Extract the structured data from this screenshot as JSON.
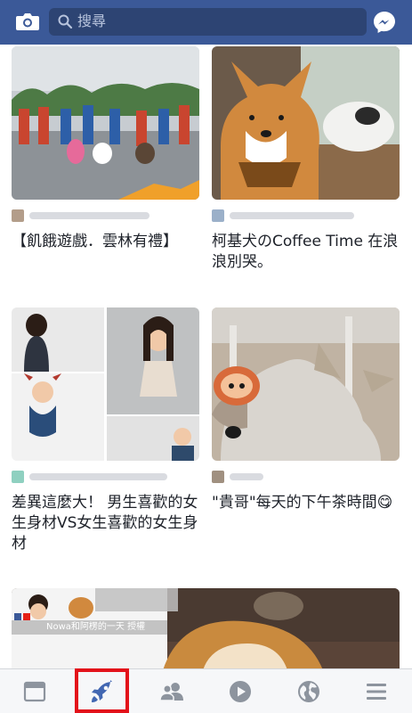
{
  "search": {
    "placeholder": "搜尋"
  },
  "cards": [
    {
      "title": "【飢餓遊戲．雲林有禮】"
    },
    {
      "title": "柯基犬のCoffee Time 在浪浪別哭。"
    },
    {
      "title": "差異這麼大！ 男生喜歡的女生身材VS女生喜歡的女生身材"
    },
    {
      "title": "\"貴哥\"每天的下午茶時間😋"
    }
  ],
  "video_card": {
    "caption": "Nowa和阿楞的一天 授權"
  },
  "bottom_nav": {
    "items": [
      "news-feed-tab",
      "explore-tab",
      "friends-tab",
      "video-tab",
      "notifications-tab",
      "menu-tab"
    ],
    "selected": "explore-tab"
  },
  "colors": {
    "brand": "#3b5998",
    "highlight": "#e3111a",
    "active_tab": "#4267b2",
    "icon": "#8d949e"
  }
}
